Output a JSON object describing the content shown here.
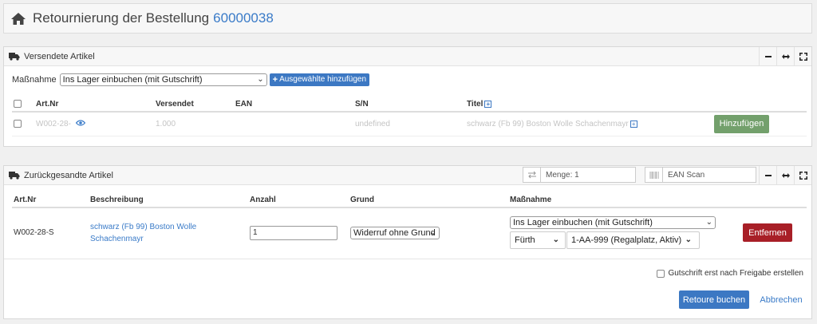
{
  "header": {
    "title": "Retournierung der Bestellung",
    "order_number": "60000038"
  },
  "shipped_panel": {
    "title": "Versendete Artikel",
    "action_label": "Maßnahme",
    "action_value": "Ins Lager einbuchen (mit Gutschrift)",
    "add_selected_label": "Ausgewählte hinzufügen",
    "columns": {
      "art_nr": "Art.Nr",
      "shipped": "Versendet",
      "ean": "EAN",
      "sn": "S/N",
      "title": "Titel"
    },
    "row": {
      "art_nr": "W002-28-",
      "shipped": "1.000",
      "ean": "",
      "sn": "undefined",
      "title": "schwarz (Fb 99) Boston Wolle Schachenmayr",
      "add_label": "Hinzufügen"
    }
  },
  "returned_panel": {
    "title": "Zurückgesandte Artikel",
    "qty_placeholder": "Menge: 1",
    "ean_placeholder": "EAN Scan",
    "columns": {
      "art_nr": "Art.Nr",
      "description": "Beschreibung",
      "quantity": "Anzahl",
      "reason": "Grund",
      "action": "Maßnahme"
    },
    "row": {
      "art_nr": "W002-28-S",
      "description_line1": "schwarz (Fb 99) Boston Wolle",
      "description_line2": "Schachenmayr",
      "quantity": "1",
      "reason": "Widerruf ohne Grund",
      "action": "Ins Lager einbuchen (mit Gutschrift)",
      "location": "Fürth",
      "storage": "1-AA-999 (Regalplatz, Aktiv)",
      "remove_label": "Entfernen"
    },
    "credit_checkbox_label": "Gutschrift erst nach Freigabe erstellen",
    "book_label": "Retoure buchen",
    "cancel_label": "Abbrechen"
  },
  "colors": {
    "primary": "#3c78c3",
    "success": "#73a06c",
    "danger": "#a81f27",
    "link": "#3a7bc8"
  }
}
